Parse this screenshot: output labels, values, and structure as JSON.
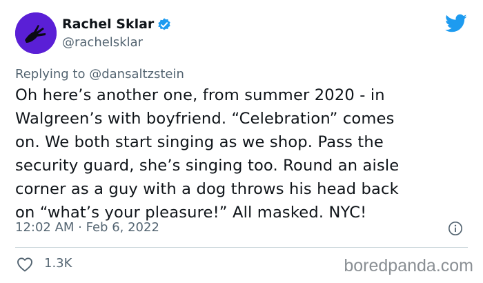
{
  "author": {
    "display_name": "Rachel Sklar",
    "handle": "@rachelsklar",
    "verified": true,
    "avatar_color": "#5a1fd6"
  },
  "reply": {
    "prefix": "Replying to",
    "mention": "@dansaltzstein"
  },
  "tweet": {
    "lines": [
      "Oh here’s another one, from summer 2020 - in",
      "Walgreen’s with boyfriend. “Celebration” comes",
      "on. We both start singing as we shop. Pass the",
      "security guard, she’s singing too. Round an aisle",
      "corner as a guy with a dog throws his head back",
      "on “what’s your pleasure!” All masked. NYC!"
    ],
    "timestamp": "12:02 AM · Feb 6, 2022"
  },
  "actions": {
    "like_count": "1.3K"
  },
  "watermark": "boredpanda.com",
  "icons": {
    "brand": "twitter-bird-icon",
    "verified": "verified-badge-icon",
    "info": "info-icon",
    "like": "heart-icon"
  },
  "colors": {
    "twitter_blue": "#1d9bf0",
    "text_primary": "#0f1419",
    "text_secondary": "#536471"
  }
}
